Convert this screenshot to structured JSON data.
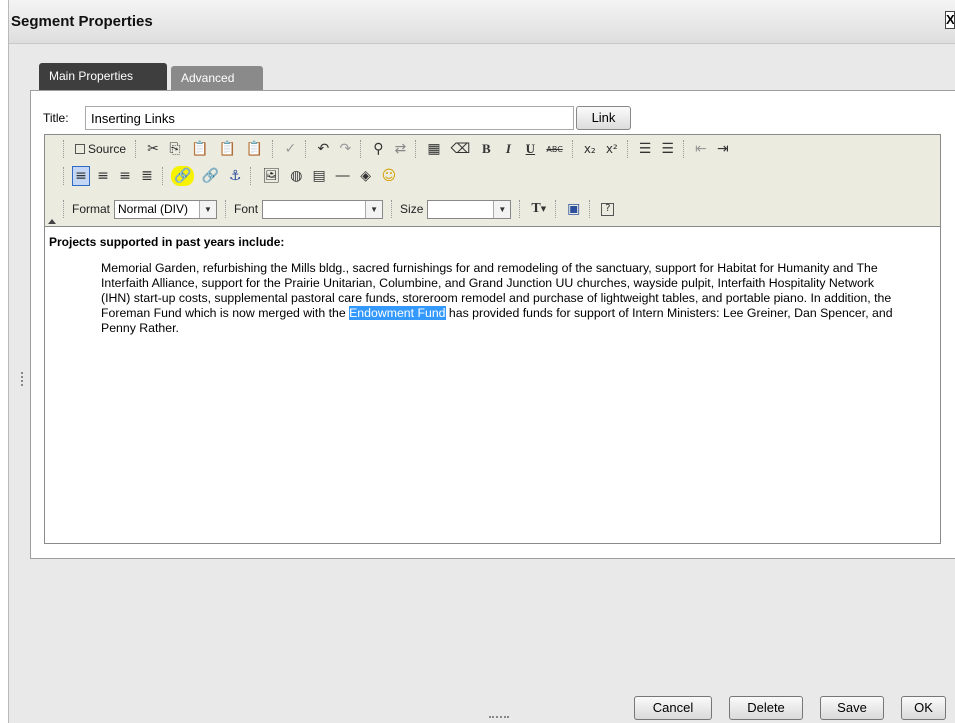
{
  "dialog": {
    "title": "Segment Properties",
    "close_label": "X"
  },
  "tabs": [
    {
      "label": "Main Properties",
      "active": true
    },
    {
      "label": "Advanced",
      "active": false
    }
  ],
  "form": {
    "title_label": "Title:",
    "title_value": "Inserting Links",
    "link_button": "Link"
  },
  "toolbar": {
    "source_label": "Source",
    "format_label": "Format",
    "format_value": "Normal (DIV)",
    "font_label": "Font",
    "font_value": "",
    "size_label": "Size",
    "size_value": "",
    "bold": "B",
    "italic": "I",
    "underline": "U",
    "strike": "ABC",
    "subscript": "x₂",
    "superscript": "x²"
  },
  "content": {
    "heading": "Projects supported in past years include:",
    "paragraph_before": "Memorial Garden, refurbishing the Mills bldg., sacred furnishings for and remodeling of the sanctuary, support for Habitat for Humanity and The Interfaith Alliance, support for the Prairie Unitarian, Columbine, and Grand Junction UU churches, wayside pulpit, Interfaith Hospitality Network (IHN) start-up costs, supplemental pastoral care funds, storeroom remodel and purchase of lightweight tables, and portable piano. In addition, the Foreman Fund which is now merged with the ",
    "selected_text": "Endowment Fund",
    "paragraph_after": " has provided funds for support of Intern Ministers: Lee Greiner, Dan Spencer, and Penny Rather."
  },
  "footer": {
    "cancel": "Cancel",
    "delete": "Delete",
    "save": "Save",
    "ok": "OK"
  },
  "colors": {
    "selection": "#3399ff",
    "highlight": "#f7f200",
    "active_tab": "#3e3e3e"
  }
}
